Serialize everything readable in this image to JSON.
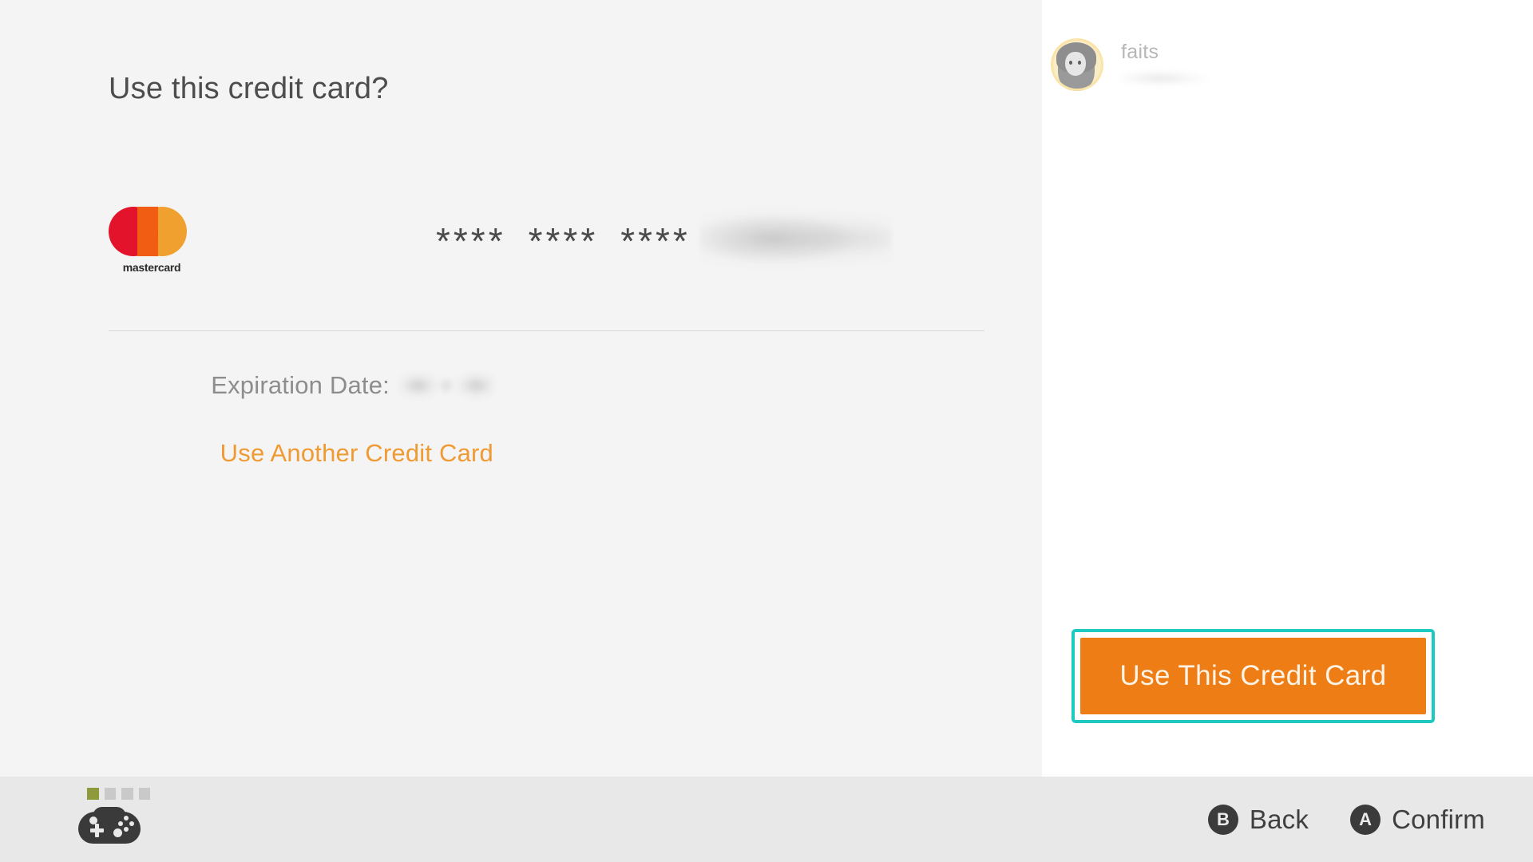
{
  "screen": {
    "title": "Use this credit card?",
    "background_left": "#f4f4f4",
    "background_right": "#ffffff",
    "bottom_bar_color": "#e8e8e8"
  },
  "card": {
    "brand": "mastercard",
    "brand_wordmark": "mastercard",
    "number_groups": [
      "****",
      "****",
      "****"
    ],
    "number_last_group": "redacted",
    "expiration_label": "Expiration Date:",
    "expiration_value": "redacted",
    "another_card_link": "Use Another Credit Card",
    "link_color": "#f09a33"
  },
  "user": {
    "name": "faits",
    "subline": "redacted",
    "avatar_icon": "user-avatar-icon"
  },
  "cta": {
    "label": "Use This Credit Card",
    "button_color": "#ef7d15",
    "focus_ring_color": "#1ec9c2",
    "text_color": "#fdf3e6"
  },
  "bottom_bar": {
    "controller_icon": "gamepad-icon",
    "player_leds": [
      {
        "active": true,
        "color": "#8f9a3c"
      },
      {
        "active": false,
        "color": "#c9c9c9"
      },
      {
        "active": false,
        "color": "#c9c9c9"
      },
      {
        "active": false,
        "color": "#c9c9c9"
      }
    ],
    "hints": [
      {
        "badge": "B",
        "label": "Back"
      },
      {
        "badge": "A",
        "label": "Confirm"
      }
    ]
  }
}
